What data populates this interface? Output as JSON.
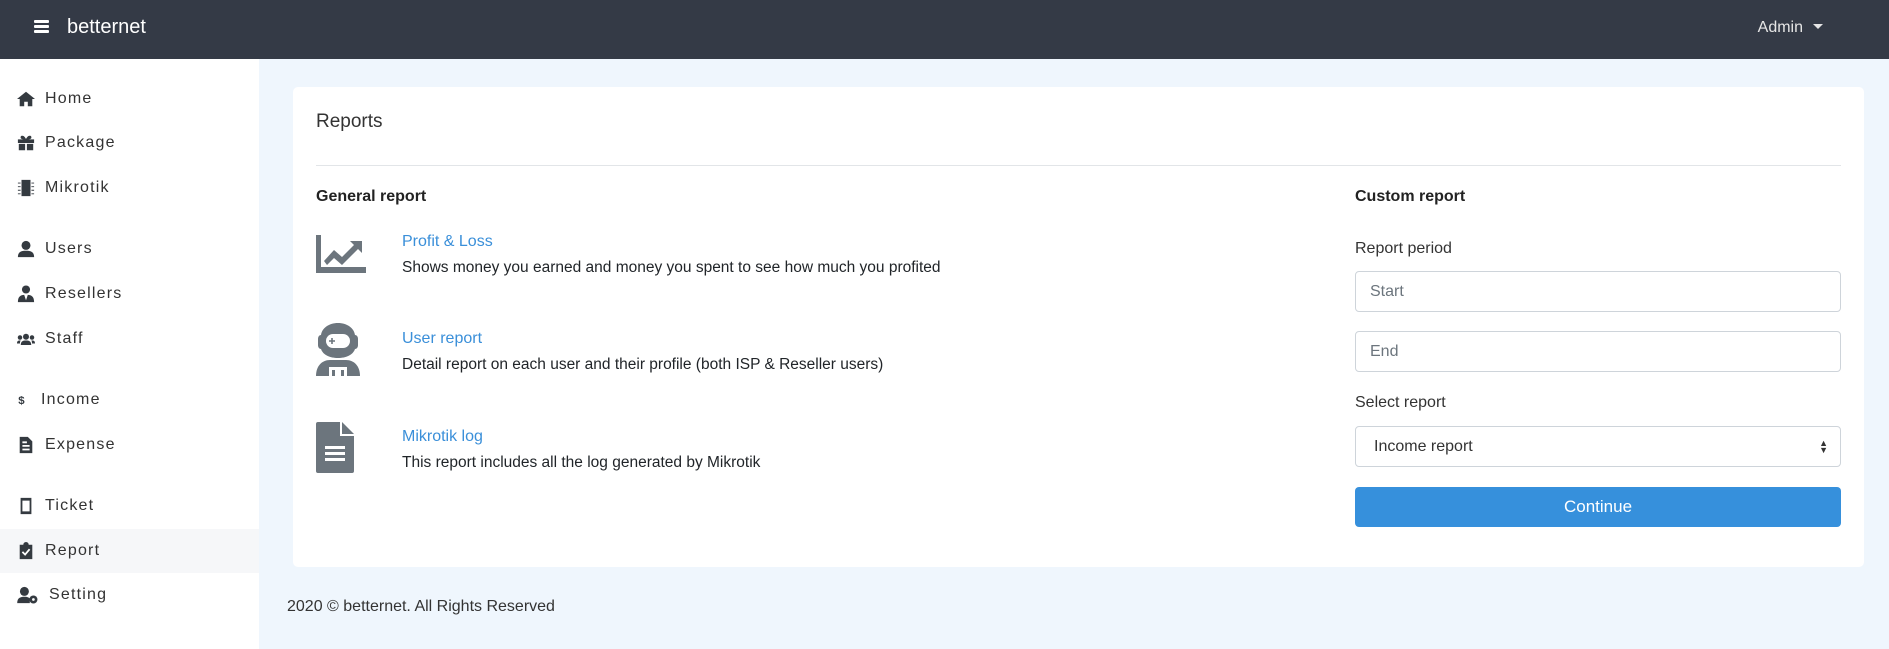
{
  "navbar": {
    "brand": "betternet",
    "user_menu": "Admin"
  },
  "sidebar": {
    "items": [
      {
        "label": "Home",
        "icon": "home-icon"
      },
      {
        "label": "Package",
        "icon": "gift-icon"
      },
      {
        "label": "Mikrotik",
        "icon": "chip-icon"
      },
      {
        "label": "Users",
        "icon": "user-icon"
      },
      {
        "label": "Resellers",
        "icon": "user-tie-icon"
      },
      {
        "label": "Staff",
        "icon": "users-icon"
      },
      {
        "label": "Income",
        "icon": "dollar-icon"
      },
      {
        "label": "Expense",
        "icon": "file-invoice-icon"
      },
      {
        "label": "Ticket",
        "icon": "ticket-icon"
      },
      {
        "label": "Report",
        "icon": "clipboard-check-icon",
        "active": true
      },
      {
        "label": "Setting",
        "icon": "user-cog-icon"
      }
    ]
  },
  "main": {
    "title": "Reports",
    "general": {
      "heading": "General report",
      "items": [
        {
          "title": "Profit & Loss",
          "desc": "Shows money you earned and money you spent to see how much you profited",
          "icon": "chart-line-icon"
        },
        {
          "title": "User report",
          "desc": "Detail report on each user and their profile (both ISP & Reseller users)",
          "icon": "user-astronaut-icon"
        },
        {
          "title": "Mikrotik log",
          "desc": "This report includes all the log generated by Mikrotik",
          "icon": "file-alt-icon"
        }
      ]
    },
    "custom": {
      "heading": "Custom report",
      "period_label": "Report period",
      "start_placeholder": "Start",
      "end_placeholder": "End",
      "select_label": "Select report",
      "selected": "Income report",
      "button": "Continue"
    }
  },
  "footer": "2020 © betternet. All Rights Reserved",
  "colors": {
    "navbar": "#343a46",
    "accent": "#3690dc",
    "link": "#3a8fd9"
  }
}
